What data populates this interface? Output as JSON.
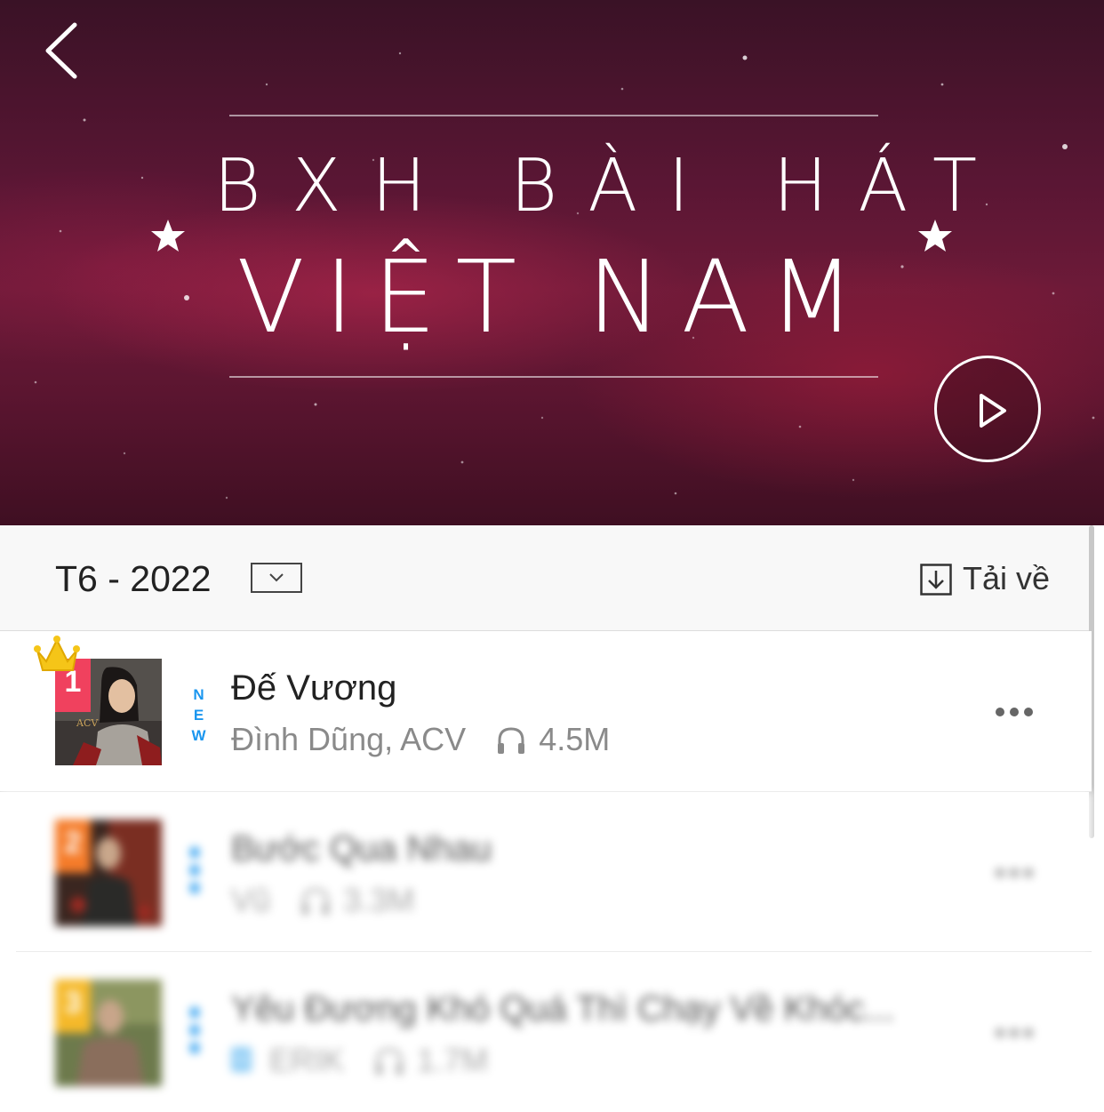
{
  "banner": {
    "title_line_1": "BXH BÀI HÁT",
    "title_line_2": "VIỆT NAM",
    "colors": {
      "background_dark": "#3a1226",
      "background_mid": "#6d1a38",
      "text": "#ffffff"
    }
  },
  "icons": {
    "back": "chevron-left-icon",
    "play": "play-icon",
    "dropdown": "chevron-down-icon",
    "download": "download-icon",
    "plays": "headphones-icon",
    "more": "more-horizontal-icon",
    "crown": "crown-icon",
    "star": "star-icon"
  },
  "chart_header": {
    "period": "T6 - 2022",
    "download_label": "Tải về"
  },
  "songs": [
    {
      "rank": "1",
      "rank_color": "#f0415e",
      "title": "Đế Vương",
      "artist": "Đình Dũng, ACV",
      "plays": "4.5M",
      "new_tag": "NEW",
      "has_crown": true
    },
    {
      "rank": "2",
      "rank_color": "#f57c2a",
      "title": "Bước Qua Nhau",
      "artist": "Vũ",
      "plays": "3.3M",
      "new_tag": "NEW"
    },
    {
      "rank": "3",
      "rank_color": "#f5b92a",
      "title": "Yêu Đương Khó Quá Thì Chạy Về Khóc...",
      "artist": "ERIK",
      "plays": "1.7M",
      "new_tag": "NEW",
      "badge": "M"
    }
  ],
  "accent_color": "#1a96ef"
}
